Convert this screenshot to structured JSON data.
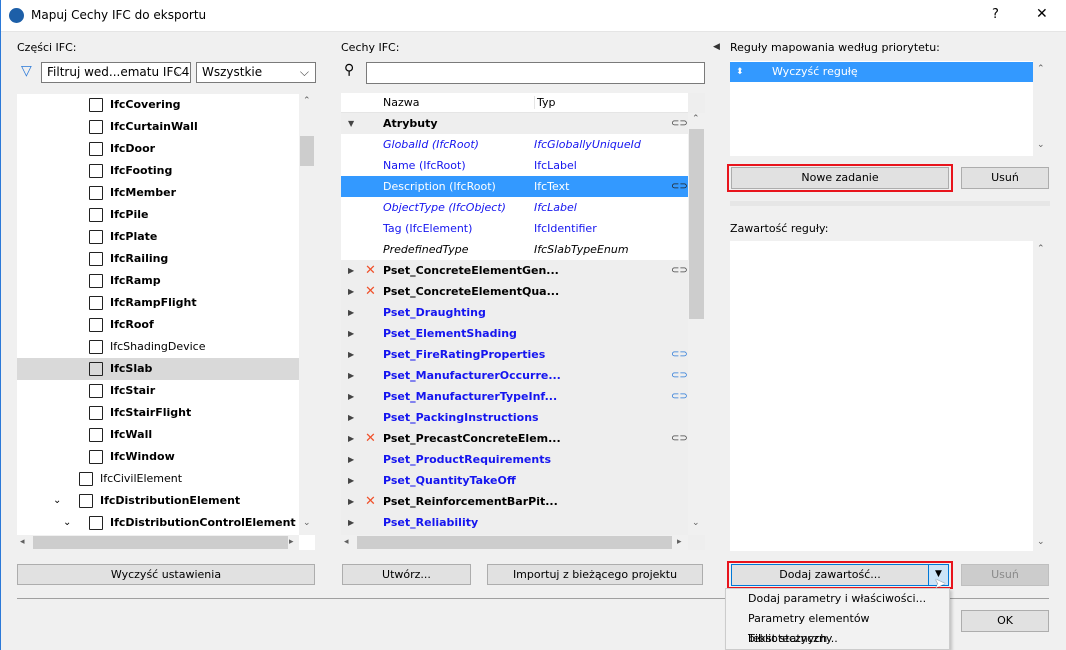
{
  "window": {
    "title": "Mapuj Cechy IFC do eksportu",
    "help": "?",
    "close": "✕"
  },
  "left": {
    "label": "Części IFC:",
    "filter_value": "Filtruj wed...ematu IFC4",
    "scope_value": "Wszystkie",
    "tree": [
      {
        "label": "IfcCovering",
        "depth": 2
      },
      {
        "label": "IfcCurtainWall",
        "depth": 2
      },
      {
        "label": "IfcDoor",
        "depth": 2
      },
      {
        "label": "IfcFooting",
        "depth": 2
      },
      {
        "label": "IfcMember",
        "depth": 2
      },
      {
        "label": "IfcPile",
        "depth": 2
      },
      {
        "label": "IfcPlate",
        "depth": 2
      },
      {
        "label": "IfcRailing",
        "depth": 2
      },
      {
        "label": "IfcRamp",
        "depth": 2
      },
      {
        "label": "IfcRampFlight",
        "depth": 2
      },
      {
        "label": "IfcRoof",
        "depth": 2
      },
      {
        "label": "IfcShadingDevice",
        "depth": 2,
        "normal": true
      },
      {
        "label": "IfcSlab",
        "depth": 2,
        "selected": true
      },
      {
        "label": "IfcStair",
        "depth": 2
      },
      {
        "label": "IfcStairFlight",
        "depth": 2
      },
      {
        "label": "IfcWall",
        "depth": 2
      },
      {
        "label": "IfcWindow",
        "depth": 2
      },
      {
        "label": "IfcCivilElement",
        "depth": 1,
        "normal": true
      },
      {
        "label": "IfcDistributionElement",
        "depth": 1,
        "expander": true
      },
      {
        "label": "IfcDistributionControlElement",
        "depth": 2,
        "expander": true
      }
    ],
    "clear_button": "Wyczyść ustawienia"
  },
  "middle": {
    "label": "Cechy IFC:",
    "search_value": "",
    "col_name": "Nazwa",
    "col_type": "Typ",
    "rows": [
      {
        "name": "Atrybuty",
        "group": true,
        "expanded": true,
        "link": "dark"
      },
      {
        "name": "GlobalId (IfcRoot)",
        "type": "IfcGloballyUniqueId",
        "style": "blue-it"
      },
      {
        "name": "Name (IfcRoot)",
        "type": "IfcLabel",
        "style": "blue"
      },
      {
        "name": "Description (IfcRoot)",
        "type": "IfcText",
        "style": "selected",
        "link": "dark"
      },
      {
        "name": "ObjectType (IfcObject)",
        "type": "IfcLabel",
        "style": "blue-it"
      },
      {
        "name": "Tag (IfcElement)",
        "type": "IfcIdentifier",
        "style": "blue"
      },
      {
        "name": "PredefinedType",
        "type": "IfcSlabTypeEnum",
        "style": "it"
      },
      {
        "name": "Pset_ConcreteElementGen...",
        "pset": true,
        "x": true,
        "link": "dark"
      },
      {
        "name": "Pset_ConcreteElementQua...",
        "pset": true,
        "x": true
      },
      {
        "name": "Pset_Draughting",
        "pset": true,
        "blue": true
      },
      {
        "name": "Pset_ElementShading",
        "pset": true,
        "blue": true
      },
      {
        "name": "Pset_FireRatingProperties",
        "pset": true,
        "blue": true,
        "link": "blue"
      },
      {
        "name": "Pset_ManufacturerOccurre...",
        "pset": true,
        "blue": true,
        "link": "blue"
      },
      {
        "name": "Pset_ManufacturerTypeInf...",
        "pset": true,
        "blue": true,
        "link": "blue"
      },
      {
        "name": "Pset_PackingInstructions",
        "pset": true,
        "blue": true
      },
      {
        "name": "Pset_PrecastConcreteElem...",
        "pset": true,
        "x": true,
        "link": "dark"
      },
      {
        "name": "Pset_ProductRequirements",
        "pset": true,
        "blue": true
      },
      {
        "name": "Pset_QuantityTakeOff",
        "pset": true,
        "blue": true
      },
      {
        "name": "Pset_ReinforcementBarPit...",
        "pset": true,
        "x": true
      },
      {
        "name": "Pset_Reliability",
        "pset": true,
        "blue": true
      }
    ],
    "create_button": "Utwórz...",
    "import_button": "Importuj z bieżącego projektu"
  },
  "right": {
    "rules_label": "Reguły mapowania według priorytetu:",
    "rules": [
      "Wyczyść regułę"
    ],
    "new_task_button": "Nowe zadanie",
    "delete_button": "Usuń",
    "content_label": "Zawartość reguły:",
    "add_content_button": "Dodaj zawartość...",
    "delete_content_button": "Usuń",
    "menu": [
      "Dodaj parametry i właściwości...",
      "Parametry elementów bibliotecznych...",
      "Tekst statyczny"
    ],
    "ok_button": "OK"
  },
  "colors": {
    "accent": "#3399ff",
    "link_blue": "#1515ef",
    "highlight": "#e8141c"
  }
}
